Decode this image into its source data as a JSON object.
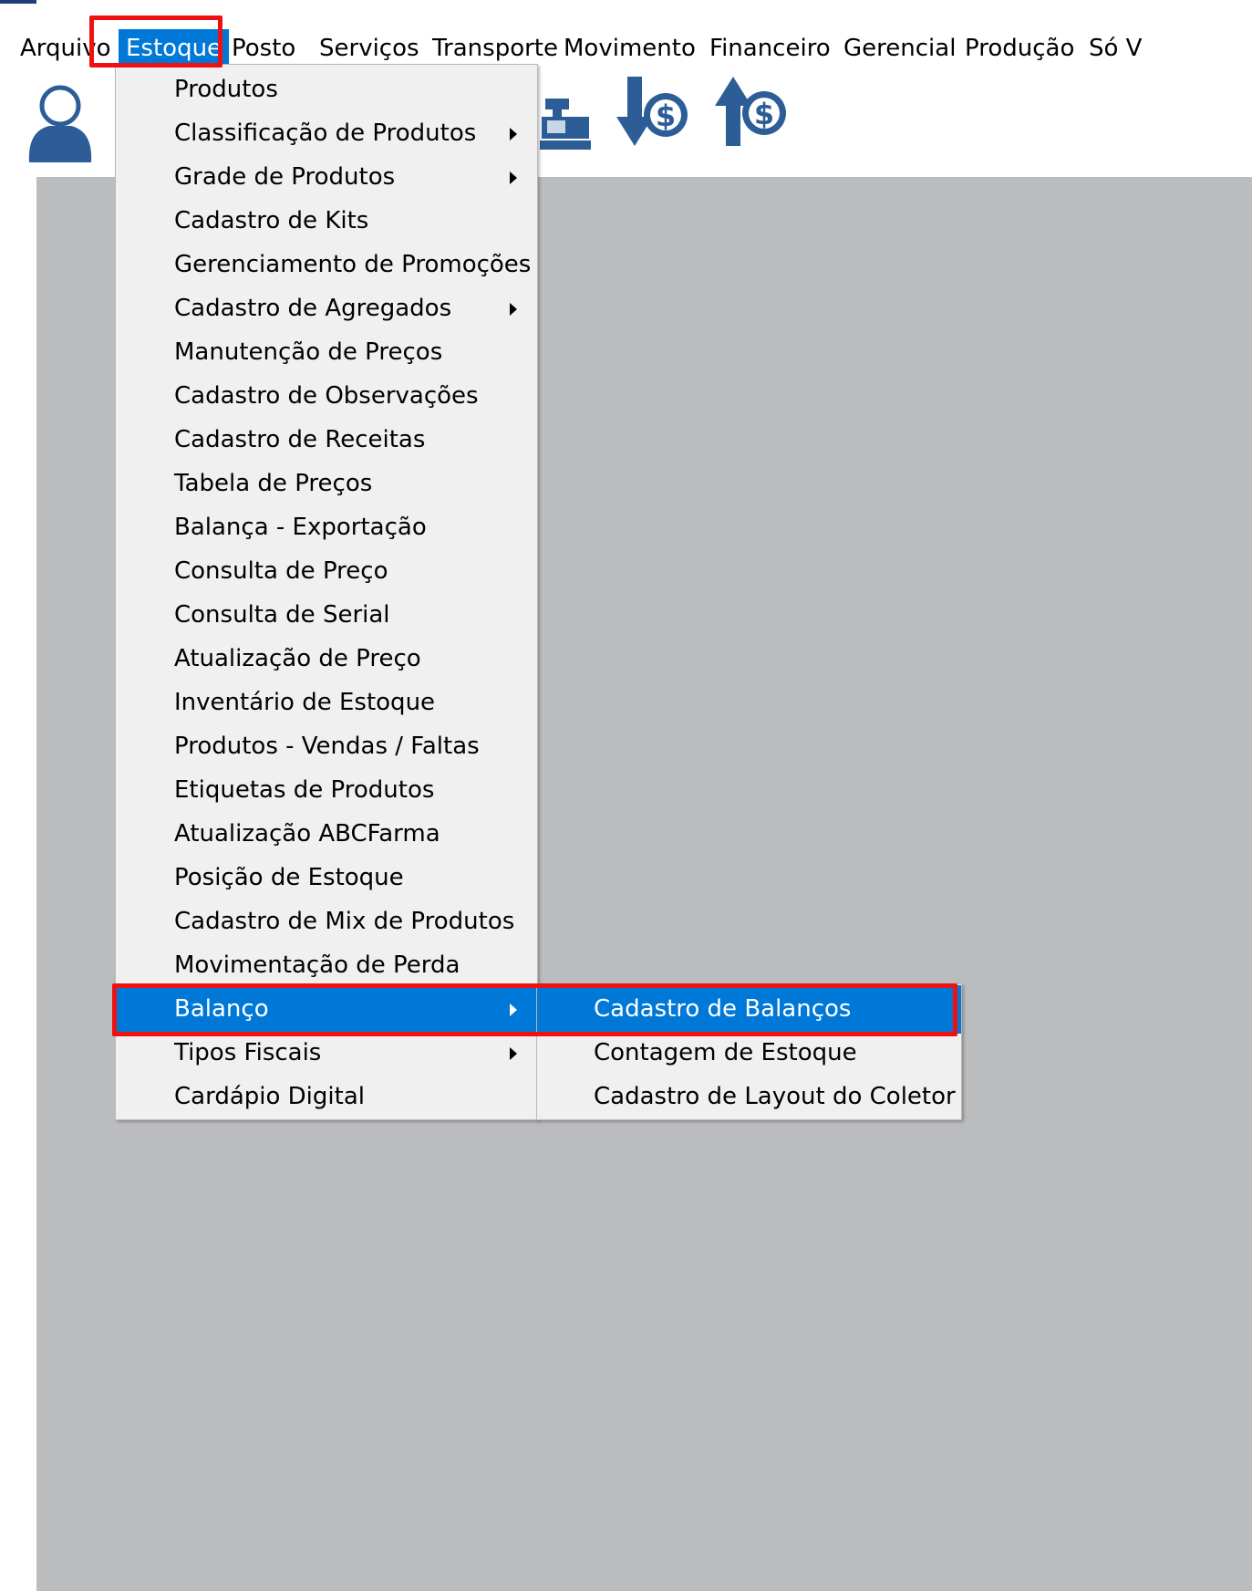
{
  "menubar": {
    "items": [
      {
        "label": "Arquivo"
      },
      {
        "label": "Estoque"
      },
      {
        "label": "Posto"
      },
      {
        "label": "Serviços"
      },
      {
        "label": "Transporte"
      },
      {
        "label": "Movimento"
      },
      {
        "label": "Financeiro"
      },
      {
        "label": "Gerencial"
      },
      {
        "label": "Produção"
      },
      {
        "label": "Só V"
      }
    ],
    "selected": "Estoque"
  },
  "toolbar": {
    "icons": [
      "user-icon",
      "cash-register-icon",
      "money-down-icon",
      "money-up-icon"
    ]
  },
  "estoque_menu": {
    "items": [
      {
        "label": "Produtos"
      },
      {
        "label": "Classificação de Produtos"
      },
      {
        "label": "Grade de Produtos"
      },
      {
        "label": "Cadastro de Kits"
      },
      {
        "label": "Gerenciamento de Promoções"
      },
      {
        "label": "Cadastro de Agregados"
      },
      {
        "label": "Manutenção de Preços"
      },
      {
        "label": "Cadastro de Observações"
      },
      {
        "label": "Cadastro de Receitas"
      },
      {
        "label": "Tabela de Preços"
      },
      {
        "label": "Balança - Exportação"
      },
      {
        "label": "Consulta de Preço"
      },
      {
        "label": "Consulta de Serial"
      },
      {
        "label": "Atualização de Preço"
      },
      {
        "label": "Inventário de Estoque"
      },
      {
        "label": "Produtos - Vendas / Faltas"
      },
      {
        "label": "Etiquetas de Produtos"
      },
      {
        "label": "Atualização ABCFarma"
      },
      {
        "label": "Posição de Estoque"
      },
      {
        "label": "Cadastro de Mix de Produtos"
      },
      {
        "label": "Movimentação de Perda"
      },
      {
        "label": "Balanço"
      },
      {
        "label": "Tipos Fiscais"
      },
      {
        "label": "Cardápio Digital"
      }
    ],
    "highlighted": "Balanço"
  },
  "balanco_submenu": {
    "items": [
      {
        "label": "Cadastro de Balanços"
      },
      {
        "label": "Contagem de Estoque"
      },
      {
        "label": "Cadastro de Layout do Coletor"
      }
    ],
    "highlighted": "Cadastro de Balanços"
  },
  "colors": {
    "highlight": "#0078d7",
    "annotation_red": "#ee1111",
    "workspace": "#bbbcbe",
    "icon_blue": "#2c5d97"
  }
}
